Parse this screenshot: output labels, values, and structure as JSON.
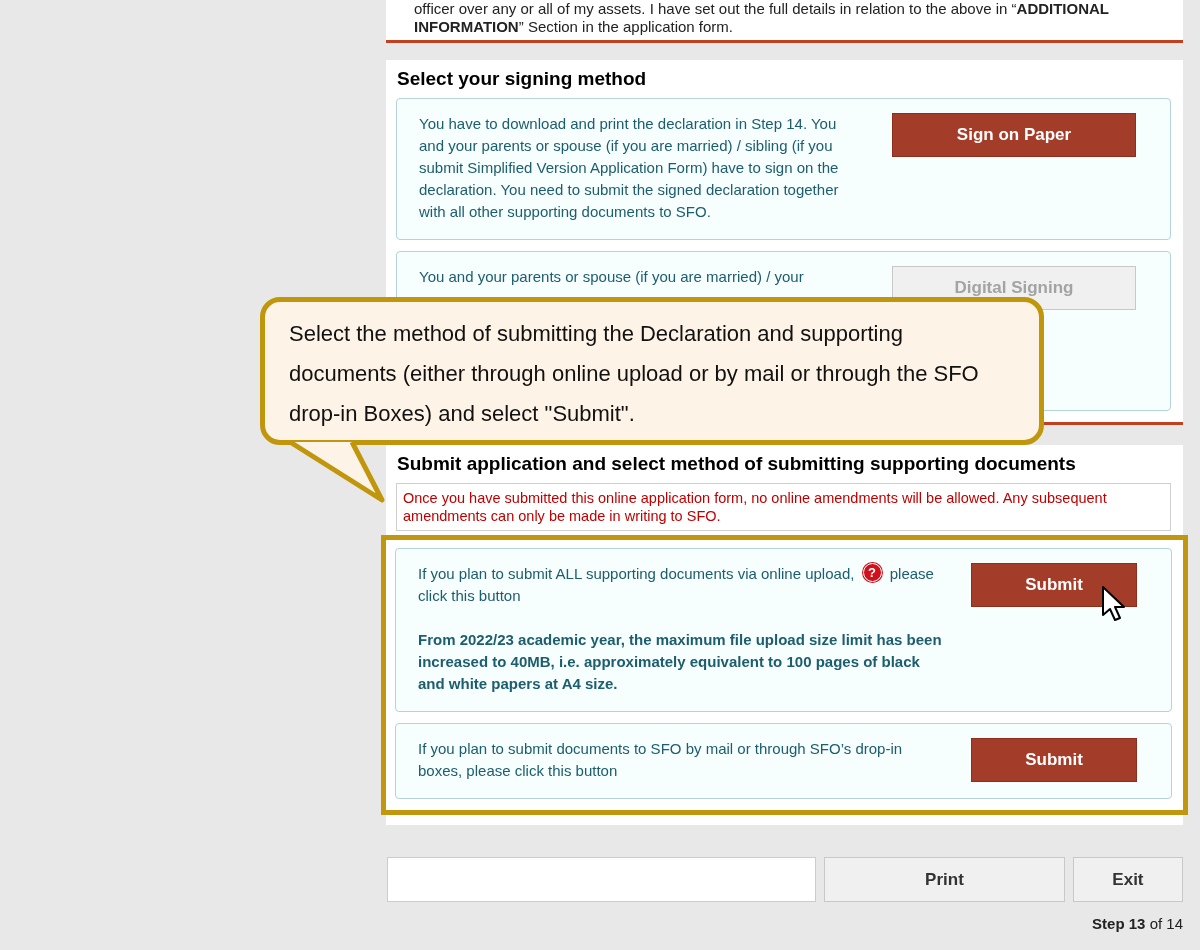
{
  "intro": {
    "text": "officer over any or all of my assets.   I have set out the full details in relation to the above in “**ADDITIONAL INFORMATION**” Section in the application form."
  },
  "signing": {
    "title": "Select your signing method",
    "options": [
      {
        "text": "You have to download and print the declaration in Step 14. You and your parents or spouse (if you are married) / sibling (if you submit Simplified Version Application Form) have to sign on the declaration. You need to submit the signed declaration together with all other supporting documents to SFO.",
        "button": "Sign on Paper",
        "disabled": false
      },
      {
        "text": "You and your parents or spouse (if you are married) / your",
        "button": "Digital Signing",
        "disabled": true
      }
    ]
  },
  "callout": {
    "text": "Select the method of submitting the Declaration and supporting documents (either through online upload or by mail or through the SFO drop-in Boxes) and select \"Submit\"."
  },
  "submit": {
    "title": "Submit application and select method of submitting supporting documents",
    "notice": "Once you have submitted this online application form, no online amendments will be allowed. Any subsequent amendments can only be made in writing to SFO.",
    "options": [
      {
        "text_before": "If you plan to submit ALL supporting documents via online upload,",
        "help_mark": "?",
        "text_after": "please click this button",
        "note": "From 2022/23 academic year, the maximum file upload size limit has been increased to 40MB, i.e. approximately equivalent to 100 pages of black and white papers at A4 size.",
        "button": "Submit",
        "disabled": false
      },
      {
        "text_before": "If you plan to submit documents to SFO by mail or through SFO’s drop-in boxes, please click this button",
        "button": "Submit",
        "disabled": false
      }
    ]
  },
  "footer": {
    "buttons": [
      "Print",
      "Exit"
    ],
    "step": "**Step 13** of 14"
  }
}
